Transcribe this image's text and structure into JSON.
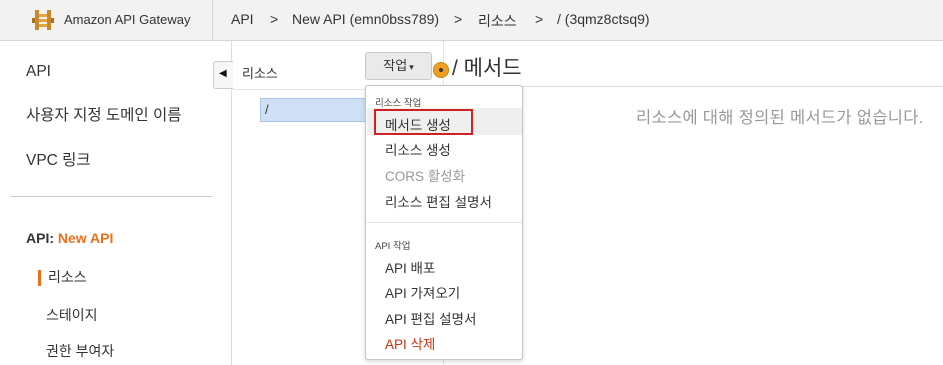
{
  "header": {
    "app_title": "Amazon API Gateway",
    "breadcrumbs": [
      "API",
      "New API (emn0bss789)",
      "리소스",
      "/ (3qmz8ctsq9)"
    ],
    "separator": ">"
  },
  "sidebar": {
    "items": [
      "API",
      "사용자 지정 도메인 이름",
      "VPC 링크"
    ],
    "api_prefix": "API:",
    "api_name": "New API",
    "sub_items": [
      "리소스",
      "스테이지",
      "권한 부여자"
    ],
    "collapse_glyph": "◀"
  },
  "resources": {
    "label": "리소스",
    "tree": [
      "/"
    ]
  },
  "actions": {
    "button_label": "작업",
    "caret": "▾",
    "groups": [
      {
        "label": "리소스 작업",
        "items": [
          {
            "label": "메서드 생성",
            "state": "focused"
          },
          {
            "label": "리소스 생성",
            "state": "normal"
          },
          {
            "label": "CORS 활성화",
            "state": "disabled"
          },
          {
            "label": "리소스 편집 설명서",
            "state": "normal"
          }
        ]
      },
      {
        "label": "API 작업",
        "items": [
          {
            "label": "API 배포",
            "state": "normal"
          },
          {
            "label": "API 가져오기",
            "state": "normal"
          },
          {
            "label": "API 편집 설명서",
            "state": "normal"
          },
          {
            "label": "API 삭제",
            "state": "danger"
          }
        ]
      }
    ]
  },
  "methods": {
    "title": "/ 메서드",
    "empty_message": "리소스에 대해 정의된 메서드가 없습니다."
  },
  "colors": {
    "accent_orange": "#e7711b",
    "danger_red": "#d13212",
    "selection_blue": "#cfe0f5"
  }
}
